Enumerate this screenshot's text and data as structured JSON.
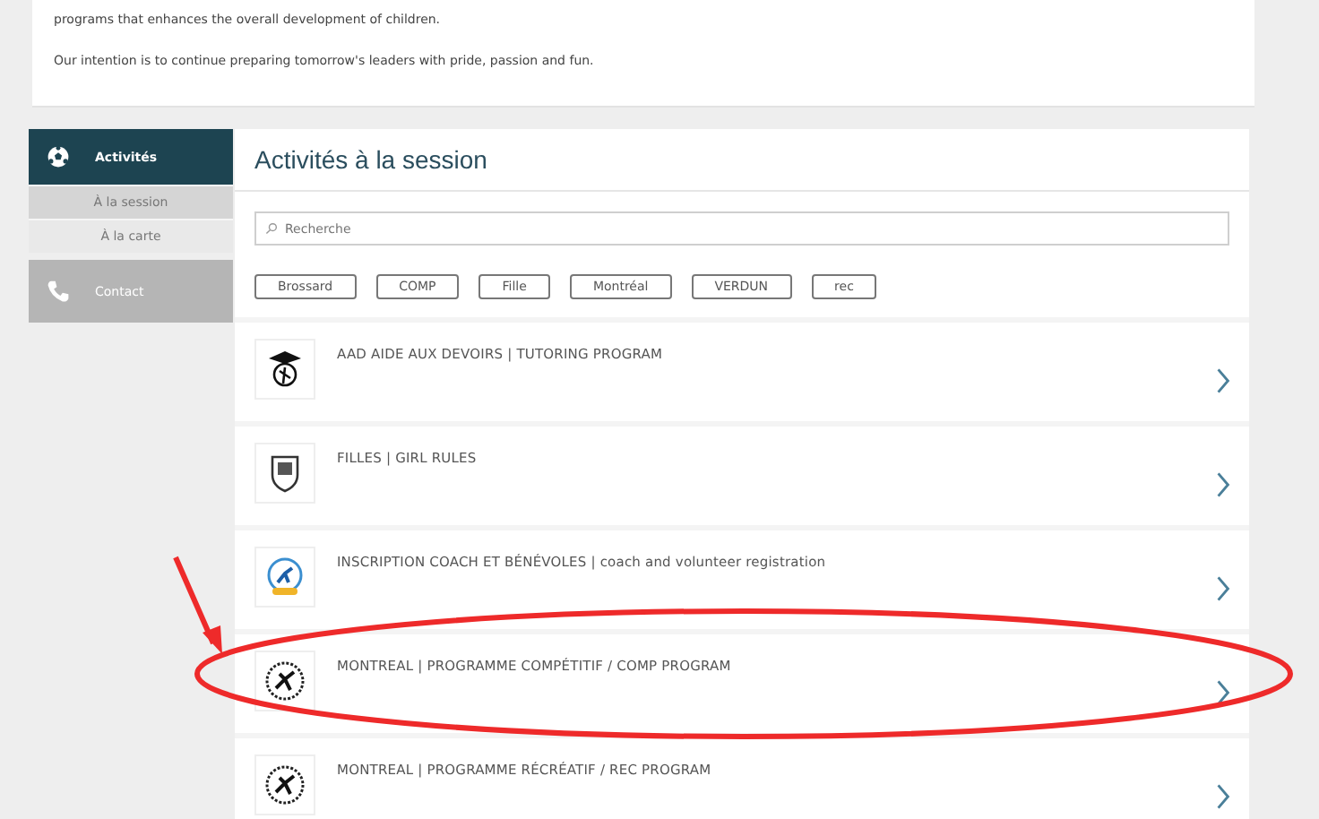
{
  "intro": {
    "paragraphs": [
      "programs that enhances the overall development of children.",
      "Our intention is to continue preparing tomorrow's leaders with pride, passion and fun."
    ]
  },
  "sidebar": {
    "items": [
      {
        "label": "Activités",
        "kind": "section",
        "children": [
          {
            "label": "À la session",
            "selected": true
          },
          {
            "label": "À la carte",
            "selected": false
          }
        ]
      },
      {
        "label": "Contact",
        "kind": "section"
      }
    ]
  },
  "main": {
    "title": "Activités à la session",
    "search": {
      "placeholder": "Recherche"
    },
    "tags": [
      "Brossard",
      "COMP",
      "Fille",
      "Montréal",
      "VERDUN",
      "rec"
    ],
    "programs": [
      {
        "title": "AAD AIDE AUX DEVOIRS | TUTORING PROGRAM",
        "kind": "crest",
        "highlighted": false
      },
      {
        "title": "FILLES | GIRL RULES",
        "kind": "shield",
        "highlighted": false
      },
      {
        "title": "INSCRIPTION COACH ET BÉNÉVOLES | coach and volunteer registration",
        "kind": "badge",
        "highlighted": false
      },
      {
        "title": "MONTREAL | PROGRAMME COMPÉTITIF / COMP PROGRAM",
        "kind": "stamp",
        "highlighted": true
      },
      {
        "title": "MONTREAL | PROGRAMME RÉCRÉATIF / REC PROGRAM",
        "kind": "stamp",
        "highlighted": false
      }
    ]
  }
}
